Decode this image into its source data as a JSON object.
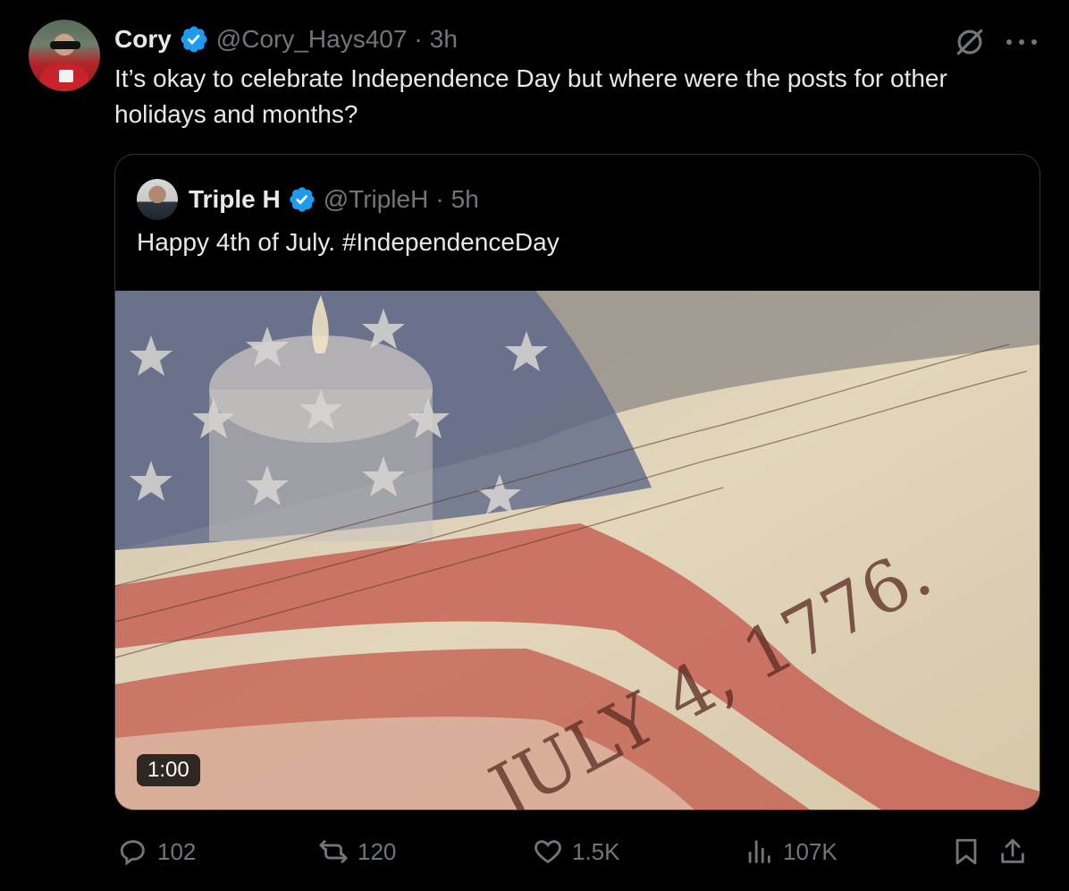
{
  "author": {
    "name": "Cory",
    "handle": "@Cory_Hays407",
    "separator": "·",
    "time": "3h"
  },
  "tweet_text": "It’s okay to celebrate Independence Day but where were the posts for other holidays and months?",
  "quoted": {
    "name": "Triple H",
    "handle": "@TripleH",
    "separator": "·",
    "time": "5h",
    "text": "Happy 4th of July. #IndependenceDay",
    "video": {
      "duration": "1:00",
      "scene_text": "JULY 4, 1776."
    }
  },
  "actions": {
    "replies": "102",
    "reposts": "120",
    "likes": "1.5K",
    "views": "107K"
  },
  "icons": {
    "verified": "verified-badge-icon",
    "grok": "grok-icon",
    "more": "more-icon",
    "reply": "reply-icon",
    "repost": "repost-icon",
    "like": "heart-icon",
    "views": "views-icon",
    "bookmark": "bookmark-icon",
    "share": "share-icon"
  },
  "colors": {
    "background": "#000000",
    "text": "#e7e9ea",
    "muted": "#71767b",
    "verified": "#1d9bf0",
    "border": "#2f3336"
  }
}
